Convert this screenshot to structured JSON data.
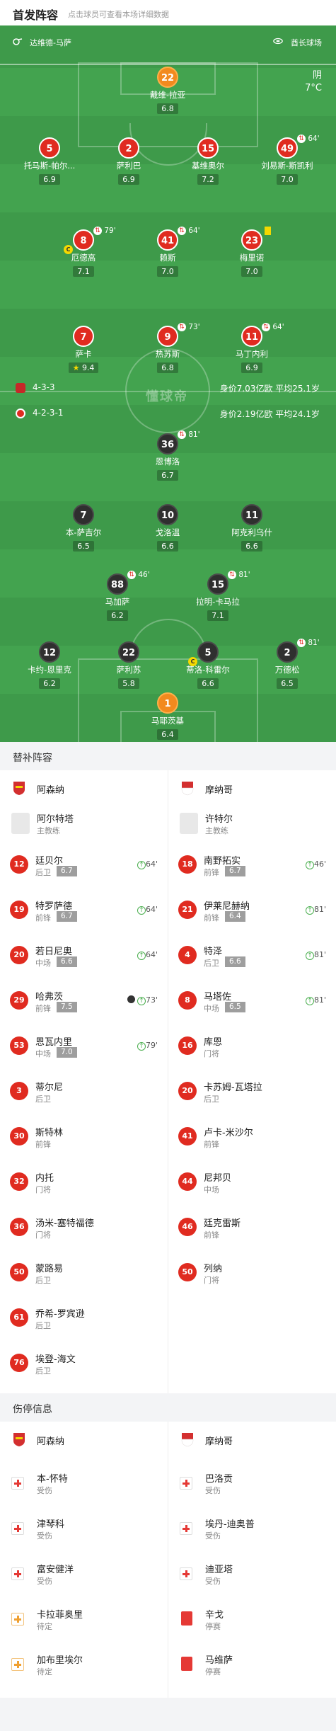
{
  "header": {
    "title": "首发阵容",
    "subtitle": "点击球员可查看本场详细数据"
  },
  "pitch": {
    "referee": "达维德-马萨",
    "venue": "酋长球场",
    "weather": "阴",
    "temperature": "7°C",
    "watermark": "懂球帝",
    "home_formation": "4-3-3",
    "home_value": "身价7.03亿欧  平均25.1岁",
    "away_formation": "4-2-3-1",
    "away_value": "身价2.19亿欧  平均24.1岁"
  },
  "home_players": [
    {
      "num": "22",
      "name": "戴维-拉亚",
      "rating": "6.8"
    },
    {
      "num": "5",
      "name": "托马斯-帕尔...",
      "rating": "6.9"
    },
    {
      "num": "2",
      "name": "萨利巴",
      "rating": "6.9"
    },
    {
      "num": "15",
      "name": "基维奥尔",
      "rating": "7.2"
    },
    {
      "num": "49",
      "name": "刘易斯-斯凯利",
      "rating": "7.0",
      "event": "64'"
    },
    {
      "num": "8",
      "name": "厄德高",
      "rating": "7.1",
      "event": "79'"
    },
    {
      "num": "41",
      "name": "赖斯",
      "rating": "7.0",
      "event": "64'"
    },
    {
      "num": "23",
      "name": "梅里诺",
      "rating": "7.0"
    },
    {
      "num": "7",
      "name": "萨卡",
      "rating": "9.4"
    },
    {
      "num": "9",
      "name": "热苏斯",
      "rating": "6.8",
      "event": "73'"
    },
    {
      "num": "11",
      "name": "马丁内利",
      "rating": "6.9",
      "event": "64'"
    }
  ],
  "away_players": [
    {
      "num": "36",
      "name": "恩博洛",
      "rating": "6.7",
      "event": "81'"
    },
    {
      "num": "7",
      "name": "本-萨吉尔",
      "rating": "6.5"
    },
    {
      "num": "10",
      "name": "戈洛温",
      "rating": "6.6"
    },
    {
      "num": "11",
      "name": "阿克利乌什",
      "rating": "6.6"
    },
    {
      "num": "88",
      "name": "马加萨",
      "rating": "6.2",
      "event": "46'"
    },
    {
      "num": "15",
      "name": "拉明-卡马拉",
      "rating": "7.1",
      "event": "81'"
    },
    {
      "num": "12",
      "name": "卡约-恩里克",
      "rating": "6.2"
    },
    {
      "num": "22",
      "name": "萨利苏",
      "rating": "5.8"
    },
    {
      "num": "5",
      "name": "蒂洛-科雷尔",
      "rating": "6.6"
    },
    {
      "num": "2",
      "name": "万德松",
      "rating": "6.5",
      "event": "81'"
    },
    {
      "num": "1",
      "name": "马耶茨基",
      "rating": "6.4"
    }
  ],
  "subs": {
    "title": "替补阵容",
    "home_team": "阿森纳",
    "away_team": "摩纳哥",
    "home_coach": {
      "name": "阿尔特塔",
      "role": "主教练"
    },
    "away_coach": {
      "name": "许特尔",
      "role": "主教练"
    },
    "home": [
      {
        "num": "12",
        "name": "廷贝尔",
        "pos": "后卫",
        "rating": "6.7",
        "event": "64'"
      },
      {
        "num": "19",
        "name": "特罗萨德",
        "pos": "前锋",
        "rating": "6.7",
        "event": "64'"
      },
      {
        "num": "20",
        "name": "若日尼奥",
        "pos": "中场",
        "rating": "6.6",
        "event": "64'"
      },
      {
        "num": "29",
        "name": "哈弗茨",
        "pos": "前锋",
        "rating": "7.5",
        "event": "73'"
      },
      {
        "num": "53",
        "name": "恩瓦内里",
        "pos": "中场",
        "rating": "7.0",
        "event": "79'"
      },
      {
        "num": "3",
        "name": "蒂尔尼",
        "pos": "后卫"
      },
      {
        "num": "30",
        "name": "斯特林",
        "pos": "前锋"
      },
      {
        "num": "32",
        "name": "内托",
        "pos": "门将"
      },
      {
        "num": "36",
        "name": "汤米-塞特福德",
        "pos": "门将"
      },
      {
        "num": "50",
        "name": "蒙路易",
        "pos": "后卫"
      },
      {
        "num": "61",
        "name": "乔希-罗宾逊",
        "pos": "后卫"
      },
      {
        "num": "76",
        "name": "埃登-海文",
        "pos": "后卫"
      }
    ],
    "away": [
      {
        "num": "18",
        "name": "南野拓实",
        "pos": "前锋",
        "rating": "6.7",
        "event": "46'"
      },
      {
        "num": "21",
        "name": "伊莱尼赫纳",
        "pos": "前锋",
        "rating": "6.4",
        "event": "81'"
      },
      {
        "num": "4",
        "name": "特泽",
        "pos": "后卫",
        "rating": "6.6",
        "event": "81'"
      },
      {
        "num": "8",
        "name": "马塔佐",
        "pos": "中场",
        "rating": "6.5",
        "event": "81'"
      },
      {
        "num": "16",
        "name": "库恩",
        "pos": "门将"
      },
      {
        "num": "20",
        "name": "卡苏姆-瓦塔拉",
        "pos": "后卫"
      },
      {
        "num": "41",
        "name": "卢卡-米沙尔",
        "pos": "前锋"
      },
      {
        "num": "44",
        "name": "尼邦贝",
        "pos": "中场"
      },
      {
        "num": "46",
        "name": "廷克雷斯",
        "pos": "前锋"
      },
      {
        "num": "50",
        "name": "列纳",
        "pos": "门将"
      }
    ]
  },
  "injuries": {
    "title": "伤停信息",
    "home_team": "阿森纳",
    "away_team": "摩纳哥",
    "home": [
      {
        "name": "本-怀特",
        "status": "受伤"
      },
      {
        "name": "津琴科",
        "status": "受伤"
      },
      {
        "name": "富安健洋",
        "status": "受伤"
      },
      {
        "name": "卡拉菲奥里",
        "status": "待定"
      },
      {
        "name": "加布里埃尔",
        "status": "待定"
      }
    ],
    "away": [
      {
        "name": "巴洛贡",
        "status": "受伤"
      },
      {
        "name": "埃丹-迪奥普",
        "status": "受伤"
      },
      {
        "name": "迪亚塔",
        "status": "受伤"
      },
      {
        "name": "辛戈",
        "status": "停赛"
      },
      {
        "name": "马维萨",
        "status": "停赛"
      }
    ]
  },
  "colors": {
    "home": "#e02b20",
    "pitch": "#3e9a4a",
    "away": "#2f2f2f"
  }
}
